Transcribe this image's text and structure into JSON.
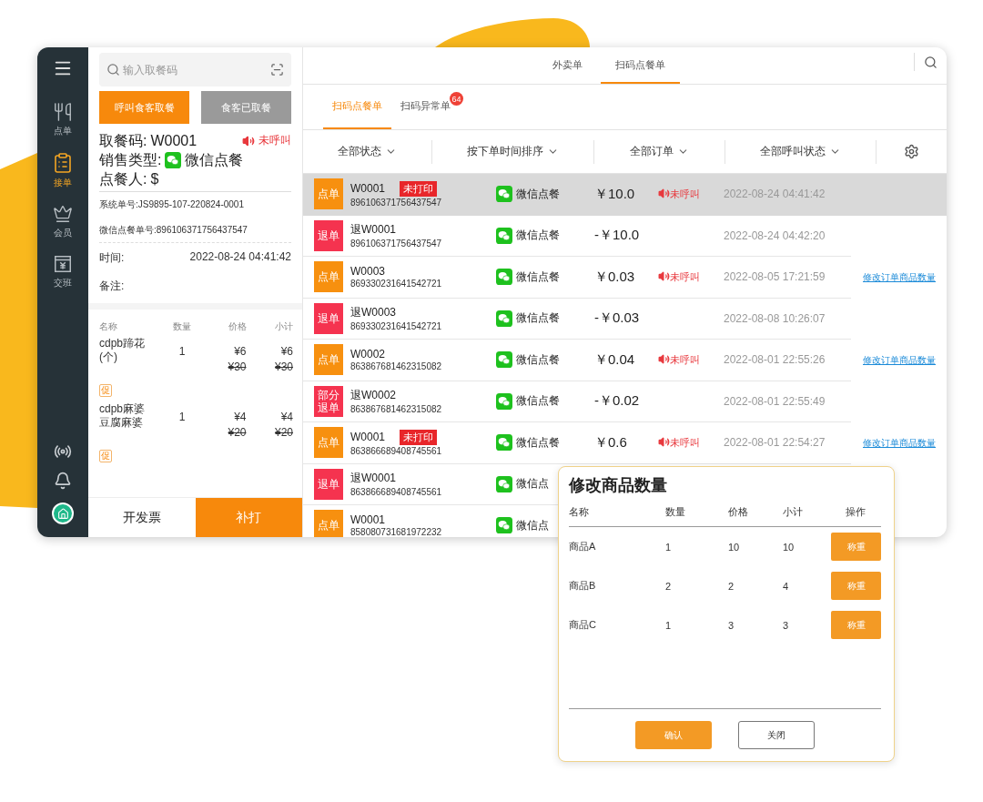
{
  "sidebar": {
    "items": [
      {
        "label": "点单",
        "selected": false
      },
      {
        "label": "接单",
        "selected": true
      },
      {
        "label": "会员",
        "selected": false
      },
      {
        "label": "交班",
        "selected": false
      }
    ]
  },
  "left_panel": {
    "search": {
      "placeholder": "输入取餐码"
    },
    "buttons": [
      {
        "label": "呼叫食客取餐",
        "kind": "primary"
      },
      {
        "label": "食客已取餐",
        "kind": "secondary"
      }
    ],
    "pickup_code_label": "取餐码:",
    "pickup_code": "W0001",
    "call_status": "未呼叫",
    "sale_type_label": "销售类型:",
    "sale_type": "微信点餐",
    "orderer_label": "点餐人:",
    "orderer": "$",
    "system_no": "系统单号:JS9895-107-220824-0001",
    "wechat_no": "微信点餐单号:896106371756437547",
    "time_label": "时间:",
    "time": "2022-08-24 04:41:42",
    "note_label": "备注:",
    "item_columns": [
      "名称",
      "数量",
      "价格",
      "小计"
    ],
    "items": [
      {
        "name": "cdpb蹄花(个)",
        "qty": "1",
        "price": "¥6",
        "original_price": "¥30",
        "subtotal": "¥6",
        "original_subtotal": "¥30",
        "promo": "促"
      },
      {
        "name": "cdpb麻婆豆腐麻婆",
        "qty": "1",
        "price": "¥4",
        "original_price": "¥20",
        "subtotal": "¥4",
        "original_subtotal": "¥20",
        "promo": "促"
      }
    ],
    "footer_buttons": [
      {
        "label": "开发票",
        "kind": "secondary"
      },
      {
        "label": "补打",
        "kind": "primary"
      }
    ]
  },
  "top_tabs": [
    {
      "label": "外卖单",
      "selected": false
    },
    {
      "label": "扫码点餐单",
      "selected": true
    }
  ],
  "sub_tabs": [
    {
      "label": "扫码点餐单",
      "selected": true
    },
    {
      "label": "扫码异常单",
      "selected": false,
      "badge": "64"
    }
  ],
  "filters": [
    "全部状态",
    "按下单时间排序",
    "全部订单",
    "全部呼叫状态"
  ],
  "orders": [
    {
      "selected": true,
      "tag": {
        "kind": "order",
        "label": "点单"
      },
      "code": "W0001",
      "print_badge": "未打印",
      "number": "896106371756437547",
      "channel": "微信点餐",
      "amount": "￥10.0",
      "call_status": "未呼叫",
      "time": "2022-08-24 04:41:42"
    },
    {
      "selected": false,
      "tag": {
        "kind": "refund",
        "label": "退单"
      },
      "code": "退W0001",
      "number": "896106371756437547",
      "channel": "微信点餐",
      "amount": "-￥10.0",
      "time": "2022-08-24 04:42:20"
    },
    {
      "selected": false,
      "tag": {
        "kind": "order",
        "label": "点单"
      },
      "code": "W0003",
      "number": "869330231641542721",
      "channel": "微信点餐",
      "amount": "￥0.03",
      "call_status": "未呼叫",
      "time": "2022-08-05 17:21:59",
      "action": "修改订单商品数量"
    },
    {
      "selected": false,
      "tag": {
        "kind": "refund",
        "label": "退单"
      },
      "code": "退W0003",
      "number": "869330231641542721",
      "channel": "微信点餐",
      "amount": "-￥0.03",
      "time": "2022-08-08 10:26:07"
    },
    {
      "selected": false,
      "tag": {
        "kind": "order",
        "label": "点单"
      },
      "code": "W0002",
      "number": "863867681462315082",
      "channel": "微信点餐",
      "amount": "￥0.04",
      "call_status": "未呼叫",
      "time": "2022-08-01 22:55:26",
      "action": "修改订单商品数量"
    },
    {
      "selected": false,
      "tag": {
        "kind": "refund",
        "label": "部分退单"
      },
      "code": "退W0002",
      "number": "863867681462315082",
      "channel": "微信点餐",
      "amount": "-￥0.02",
      "time": "2022-08-01 22:55:49"
    },
    {
      "selected": false,
      "tag": {
        "kind": "order",
        "label": "点单"
      },
      "code": "W0001",
      "print_badge": "未打印",
      "number": "863866689408745561",
      "channel": "微信点餐",
      "amount": "￥0.6",
      "call_status": "未呼叫",
      "time": "2022-08-01 22:54:27",
      "action": "修改订单商品数量"
    },
    {
      "selected": false,
      "tag": {
        "kind": "refund",
        "label": "退单"
      },
      "code": "退W0001",
      "number": "863866689408745561",
      "channel": "微信点"
    },
    {
      "selected": false,
      "tag": {
        "kind": "order",
        "label": "点单"
      },
      "code": "W0001",
      "number": "858080731681972232",
      "channel": "微信点"
    }
  ],
  "dialog": {
    "title": "修改商品数量",
    "columns": [
      "名称",
      "数量",
      "价格",
      "小计",
      "操作"
    ],
    "rows": [
      {
        "name": "商品A",
        "qty": "1",
        "price": "10",
        "subtotal": "10",
        "action": "称重"
      },
      {
        "name": "商品B",
        "qty": "2",
        "price": "2",
        "subtotal": "4",
        "action": "称重"
      },
      {
        "name": "商品C",
        "qty": "1",
        "price": "3",
        "subtotal": "3",
        "action": "称重"
      }
    ],
    "buttons": [
      {
        "label": "确认",
        "kind": "primary"
      },
      {
        "label": "关闭",
        "kind": "secondary"
      }
    ]
  }
}
